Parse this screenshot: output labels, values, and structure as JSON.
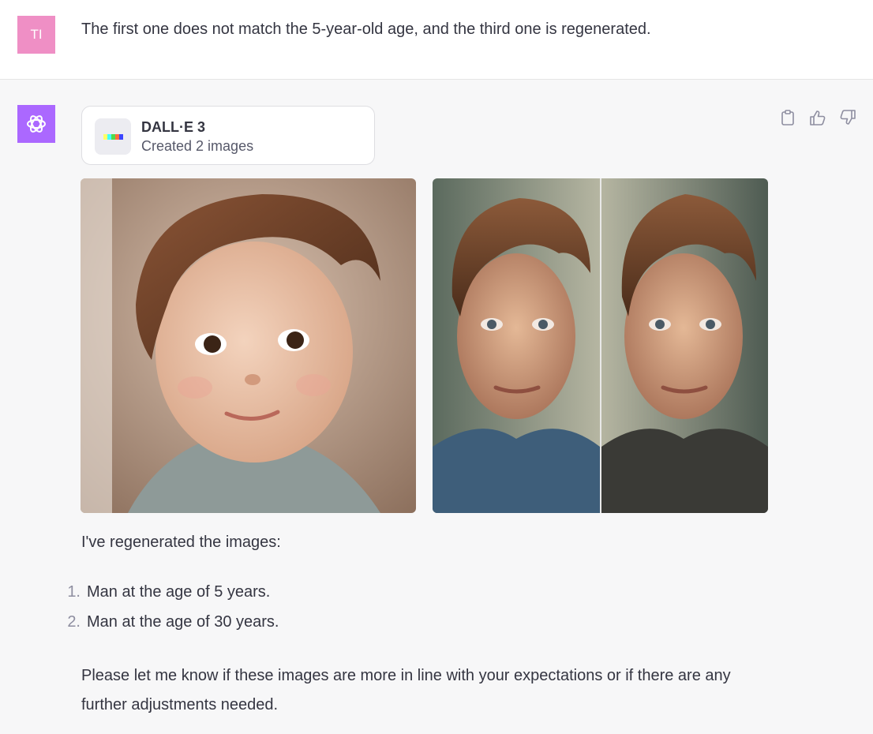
{
  "user_message": {
    "avatar_initials": "TI",
    "avatar_color": "#ef8fc5",
    "text": "The first one does not match the 5-year-old age, and the third one is regenerated."
  },
  "assistant": {
    "avatar_color": "#ab68ff",
    "avatar_icon": "openai-logo-icon",
    "tool": {
      "name": "DALL·E 3",
      "status": "Created 2 images"
    },
    "actions": [
      "copy-icon",
      "thumbs-up-icon",
      "thumbs-down-icon"
    ],
    "images": [
      {
        "subject": "child-portrait-image"
      },
      {
        "subject": "adult-portrait-image"
      }
    ],
    "intro": "I've regenerated the images:",
    "list": [
      {
        "num": "1.",
        "text": "Man at the age of 5 years."
      },
      {
        "num": "2.",
        "text": "Man at the age of 30 years."
      }
    ],
    "closing": "Please let me know if these images are more in line with your expectations or if there are any further adjustments needed."
  }
}
